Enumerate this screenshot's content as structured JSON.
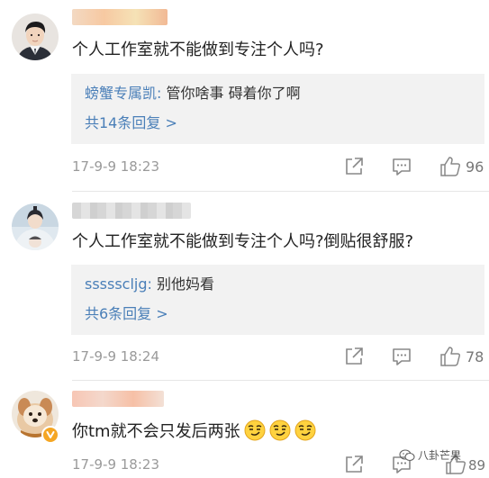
{
  "comments": [
    {
      "content": "个人工作室就不能做到专注个人吗?",
      "reply_user": "螃蟹专属凯:",
      "reply_text": " 管你啥事 碍着你了啊",
      "more_replies": "共14条回复 >",
      "timestamp": "17-9-9 18:23",
      "likes": "96",
      "avatar_icon": "man-portrait-avatar",
      "username_blur_color": "#f6c9a0"
    },
    {
      "content": "个人工作室就不能做到专注个人吗?倒贴很舒服?",
      "reply_user": "ssssscljg:",
      "reply_text": " 别他妈看",
      "more_replies": "共6条回复 >",
      "timestamp": "17-9-9 18:24",
      "likes": "78",
      "avatar_icon": "costume-portrait-avatar",
      "username_blur_color": "#d4d4d4"
    },
    {
      "content": "你tm就不会只发后两张",
      "timestamp": "17-9-9 18:23",
      "likes": "89",
      "avatar_icon": "dog-avatar",
      "badge_icon": "verified-v-badge",
      "username_blur_color": "#f7c6b4",
      "emoji_icon": "smirk-face-emoji"
    }
  ],
  "watermark": {
    "text": "八卦芒果",
    "icon": "wechat-icon"
  },
  "colors": {
    "link_blue": "#4a7fb8",
    "reply_bg": "#f2f2f2",
    "meta_gray": "#9a9a9a",
    "badge_orange": "#f5a623"
  }
}
